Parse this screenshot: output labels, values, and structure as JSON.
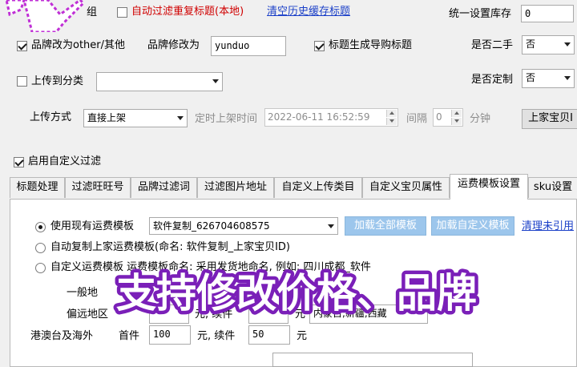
{
  "top": {
    "partial_label": "组",
    "dedupe_titles_label": "自动过滤重复标题(本地)",
    "clear_cache_link": "清空历史缓存标题",
    "stock_label": "统一设置库存",
    "stock_value": "0",
    "brand_other_label": "品牌改为other/其他",
    "brand_change_label": "品牌修改为",
    "brand_value": "yunduo",
    "shopping_title_label": "标题生成导购标题",
    "second_hand_label": "是否二手",
    "second_hand_value": "否",
    "upload_category_label": "上传到分类",
    "custom_made_label": "是否定制",
    "custom_made_value": "否",
    "upload_method_label": "上传方式",
    "upload_method_value": "直接上架",
    "schedule_label": "定时上架时间",
    "schedule_value": "2022-06-11 16:52:59",
    "interval_label": "间隔",
    "interval_value": "0",
    "minutes_label": "分钟",
    "upload_prev_button": "上家宝贝I",
    "custom_filter_label": "启用自定义过滤"
  },
  "tabs": [
    {
      "label": "标题处理"
    },
    {
      "label": "过滤旺旺号"
    },
    {
      "label": "品牌过滤词"
    },
    {
      "label": "过滤图片地址"
    },
    {
      "label": "自定义上传类目"
    },
    {
      "label": "自定义宝贝属性"
    },
    {
      "label": "运费模板设置"
    },
    {
      "label": "sku设置"
    }
  ],
  "shipping": {
    "opt1_label": "使用现有运费模板",
    "template_value": "软件复制_626704608575",
    "load_all_button": "加载全部模板",
    "load_custom_button": "加载自定义模板",
    "cleanup_link": "清理未引用",
    "opt2_label": "自动复制上家运费模板(命名: 软件复制_上家宝贝ID)",
    "opt3_label": "自定义运费模板 运费模板命名: 采用发货地命名, 例如: 四川成都_软件",
    "general_label": "一般地",
    "remote_label": "偏远地区",
    "remote_unit_partial": "元, 续件",
    "remote_unit2": "元",
    "remote_regions": "内蒙古,新疆,西藏",
    "hk_label": "港澳台及海外",
    "hk_first_label": "首件",
    "hk_first_value": "100",
    "hk_unit1": "元, 续件",
    "hk_cont_value": "50",
    "hk_unit2": "元"
  },
  "overlay": {
    "caption": "支持修改价格、品牌"
  },
  "colors": {
    "link": "#1a3fc8",
    "red_label": "#d00000",
    "caption_fill": "#ffffff",
    "caption_stroke": "#7a1fb8",
    "cursor": "#c02fd6"
  }
}
